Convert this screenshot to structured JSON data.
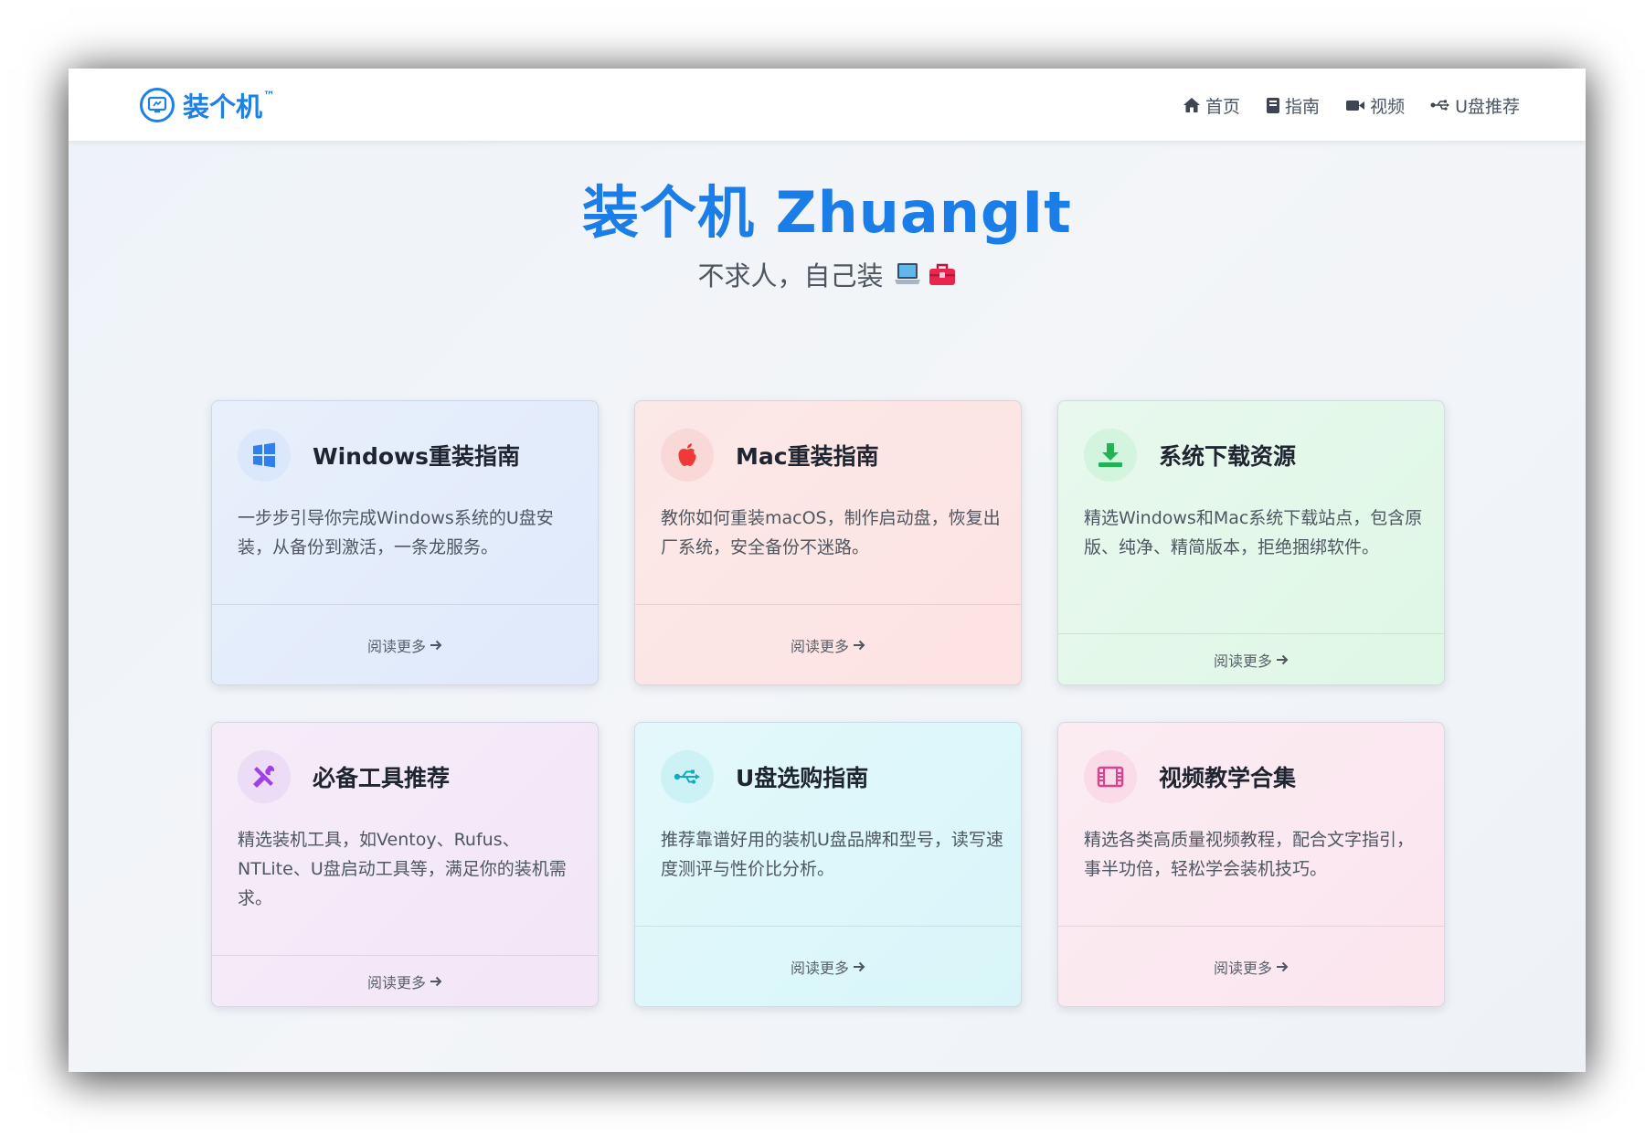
{
  "brand": {
    "name": "装个机",
    "tm": "™"
  },
  "nav": [
    {
      "label": "首页",
      "icon": "home-icon"
    },
    {
      "label": "指南",
      "icon": "book-icon"
    },
    {
      "label": "视频",
      "icon": "video-icon"
    },
    {
      "label": "U盘推荐",
      "icon": "usb-icon"
    }
  ],
  "hero": {
    "title": "装个机 ZhuangIt",
    "subtitle": "不求人，自己装",
    "emojis": [
      "laptop-icon",
      "toolbox-icon"
    ]
  },
  "cards": [
    {
      "title": "Windows重装指南",
      "desc": "一步步引导你完成Windows系统的U盘安装，从备份到激活，一条龙服务。",
      "link": "阅读更多",
      "icon": "windows-icon",
      "accent": "#3b82f6"
    },
    {
      "title": "Mac重装指南",
      "desc": "教你如何重装macOS，制作启动盘，恢复出厂系统，安全备份不迷路。",
      "link": "阅读更多",
      "icon": "apple-icon",
      "accent": "#ef4444"
    },
    {
      "title": "系统下载资源",
      "desc": "精选Windows和Mac系统下载站点，包含原版、纯净、精简版本，拒绝捆绑软件。",
      "link": "阅读更多",
      "icon": "download-icon",
      "accent": "#22c55e"
    },
    {
      "title": "必备工具推荐",
      "desc": "精选装机工具，如Ventoy、Rufus、NTLite、U盘启动工具等，满足你的装机需求。",
      "link": "阅读更多",
      "icon": "tools-icon",
      "accent": "#a855f7"
    },
    {
      "title": "U盘选购指南",
      "desc": "推荐靠谱好用的装机U盘品牌和型号，读写速度测评与性价比分析。",
      "link": "阅读更多",
      "icon": "usb-icon",
      "accent": "#06b6d4"
    },
    {
      "title": "视频教学合集",
      "desc": "精选各类高质量视频教程，配合文字指引，事半功倍，轻松学会装机技巧。",
      "link": "阅读更多",
      "icon": "film-icon",
      "accent": "#ec4899"
    }
  ]
}
